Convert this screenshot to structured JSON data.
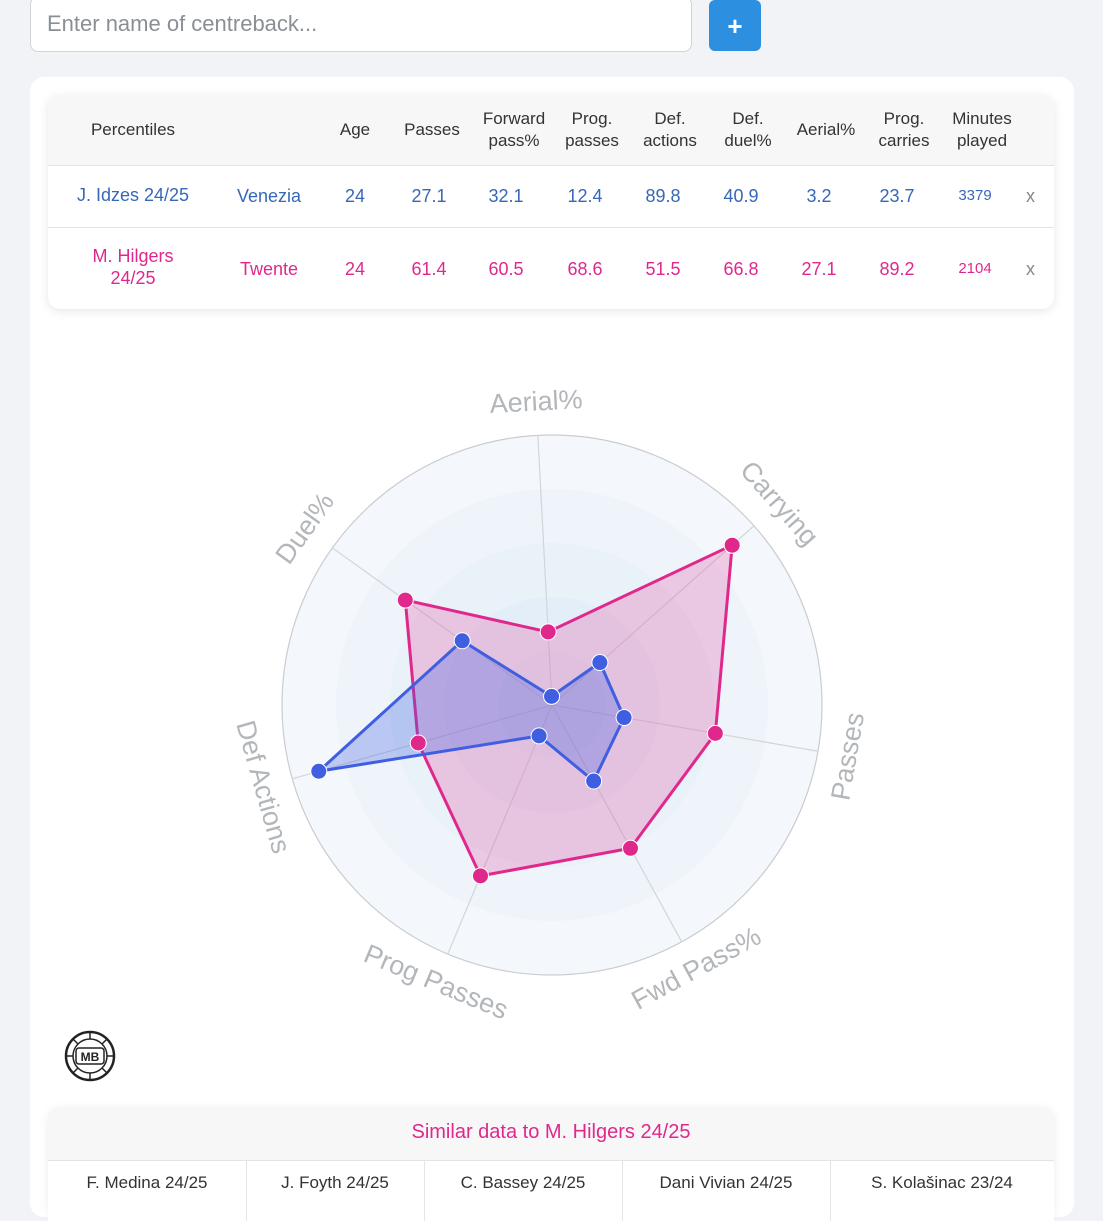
{
  "search": {
    "placeholder": "Enter name of centreback...",
    "add_label": "+"
  },
  "table": {
    "headers": [
      "Percentiles",
      "Age",
      "Passes",
      "Forward pass%",
      "Prog. passes",
      "Def. actions",
      "Def. duel%",
      "Aerial%",
      "Prog. carries",
      "Minutes played"
    ],
    "header_lines": [
      [
        "Percentiles"
      ],
      [
        "Age"
      ],
      [
        "Passes"
      ],
      [
        "Forward",
        "pass%"
      ],
      [
        "Prog.",
        "passes"
      ],
      [
        "Def.",
        "actions"
      ],
      [
        "Def.",
        "duel%"
      ],
      [
        "Aerial%"
      ],
      [
        "Prog.",
        "carries"
      ],
      [
        "Minutes",
        "played"
      ]
    ],
    "rows": [
      {
        "player": "J. Idzes 24/25",
        "player_lines": [
          "J. Idzes 24/25"
        ],
        "team": "Venezia",
        "values": [
          "24",
          "27.1",
          "32.1",
          "12.4",
          "89.8",
          "40.9",
          "3.2",
          "23.7",
          "3379"
        ],
        "remove": "x",
        "color": "#3767b8"
      },
      {
        "player": "M. Hilgers 24/25",
        "player_lines": [
          "M. Hilgers",
          "24/25"
        ],
        "team": "Twente",
        "values": [
          "24",
          "61.4",
          "60.5",
          "68.6",
          "51.5",
          "66.8",
          "27.1",
          "89.2",
          "2104"
        ],
        "remove": "x",
        "color": "#e0288c"
      }
    ]
  },
  "chart_data": {
    "type": "radar",
    "axes": [
      "Aerial%",
      "Carrying",
      "Passes",
      "Fwd Pass%",
      "Prog Passes",
      "Def Actions",
      "Duel%"
    ],
    "range": [
      0,
      100
    ],
    "series": [
      {
        "name": "J. Idzes 24/25",
        "values": [
          3.2,
          23.7,
          27.1,
          32.1,
          12.4,
          89.8,
          40.9
        ],
        "color": "#3f5fe0"
      },
      {
        "name": "M. Hilgers 24/25",
        "values": [
          27.1,
          89.2,
          61.4,
          60.5,
          68.6,
          51.5,
          66.8
        ],
        "color": "#e0288c"
      }
    ]
  },
  "logo_text": "MB",
  "similar": {
    "title": "Similar data to M. Hilgers 24/25",
    "players": [
      "F. Medina 24/25",
      "J. Foyth 24/25",
      "C. Bassey 24/25",
      "Dani Vivian 24/25",
      "S. Kolašinac 23/24"
    ]
  }
}
